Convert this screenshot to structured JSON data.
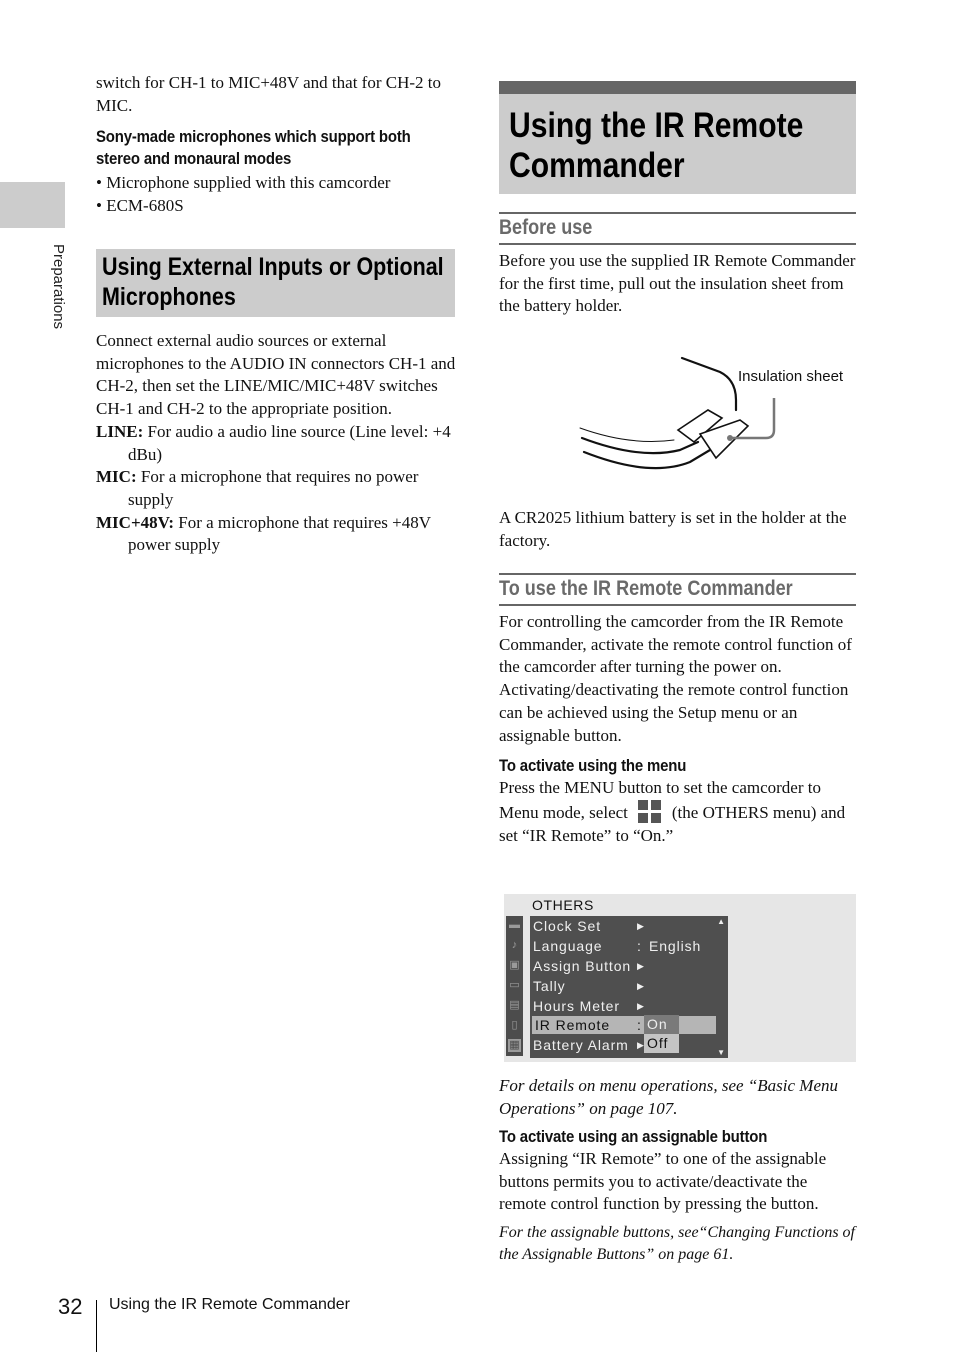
{
  "side_tab": {
    "label": "Preparations"
  },
  "left_column": {
    "intro_text": "switch for CH-1 to MIC+48V and that for CH-2 to MIC.",
    "subhead": "Sony-made microphones which support both stereo and monaural modes",
    "bullets": [
      "Microphone supplied with this camcorder",
      "ECM-680S"
    ],
    "section_title": "Using External Inputs or Optional Microphones",
    "section_body": "Connect external audio sources or external microphones to the AUDIO IN connectors CH-1 and CH-2, then set the LINE/MIC/MIC+48V switches CH-1 and CH-2 to the appropriate position.",
    "definitions": [
      {
        "term": "LINE:",
        "text": " For audio a audio line source (Line level: +4 dBu)"
      },
      {
        "term": "MIC:",
        "text": " For a microphone that requires no power supply"
      },
      {
        "term": "MIC+48V:",
        "text": " For a microphone that requires +48V power supply"
      }
    ]
  },
  "right_column": {
    "page_title": "Using the IR Remote Commander",
    "before_use": {
      "heading": "Before use",
      "body": "Before you use the supplied IR Remote Commander for the first time, pull out the insulation sheet from the battery holder.",
      "figure_label": "Insulation sheet",
      "after_figure": "A CR2025 lithium battery is set in the holder at the factory."
    },
    "to_use": {
      "heading": "To use the IR Remote Commander",
      "body1": "For controlling the camcorder from the IR Remote Commander, activate the remote control function of the camcorder after turning the power on.",
      "body2": "Activating/deactivating the remote control function can be achieved using the Setup menu or an assignable button.",
      "menu_subhead": "To activate using the menu",
      "menu_text_before": "Press the MENU button to set the camcorder to Menu mode, select",
      "menu_icon": "others-menu-icon",
      "menu_text_after": "(the OTHERS menu) and set “IR Remote” to “On.”",
      "menu_note": "For details on menu operations, see “Basic Menu Operations” on page 107.",
      "button_subhead": "To activate using an assignable button",
      "button_text": "Assigning “IR Remote” to one of the assignable buttons permits you to activate/deactivate the remote control function by pressing the button.",
      "button_note": "For the assignable buttons, see“Changing Functions of the Assignable Buttons” on page 61."
    }
  },
  "osd_menu": {
    "title": "OTHERS",
    "side_icons": [
      "camera-icon",
      "audio-note-icon",
      "video-icon",
      "lcd-icon",
      "timecode-icon",
      "remote-icon",
      "others-icon"
    ],
    "rows": [
      {
        "label": "Clock Set",
        "type": "submenu",
        "value": ""
      },
      {
        "label": "Language",
        "type": "value",
        "value": "English"
      },
      {
        "label": "Assign Button",
        "type": "submenu",
        "value": ""
      },
      {
        "label": "Tally",
        "type": "submenu",
        "value": ""
      },
      {
        "label": "Hours Meter",
        "type": "submenu",
        "value": ""
      },
      {
        "label": "IR Remote",
        "type": "value",
        "value": ""
      },
      {
        "label": "Battery Alarm",
        "type": "submenu",
        "value": ""
      }
    ],
    "options": [
      "On",
      "Off"
    ],
    "selected_row": "IR Remote",
    "highlighted_option": "Off"
  },
  "footer": {
    "page_number": "32",
    "running_title": "Using the IR Remote Commander"
  }
}
